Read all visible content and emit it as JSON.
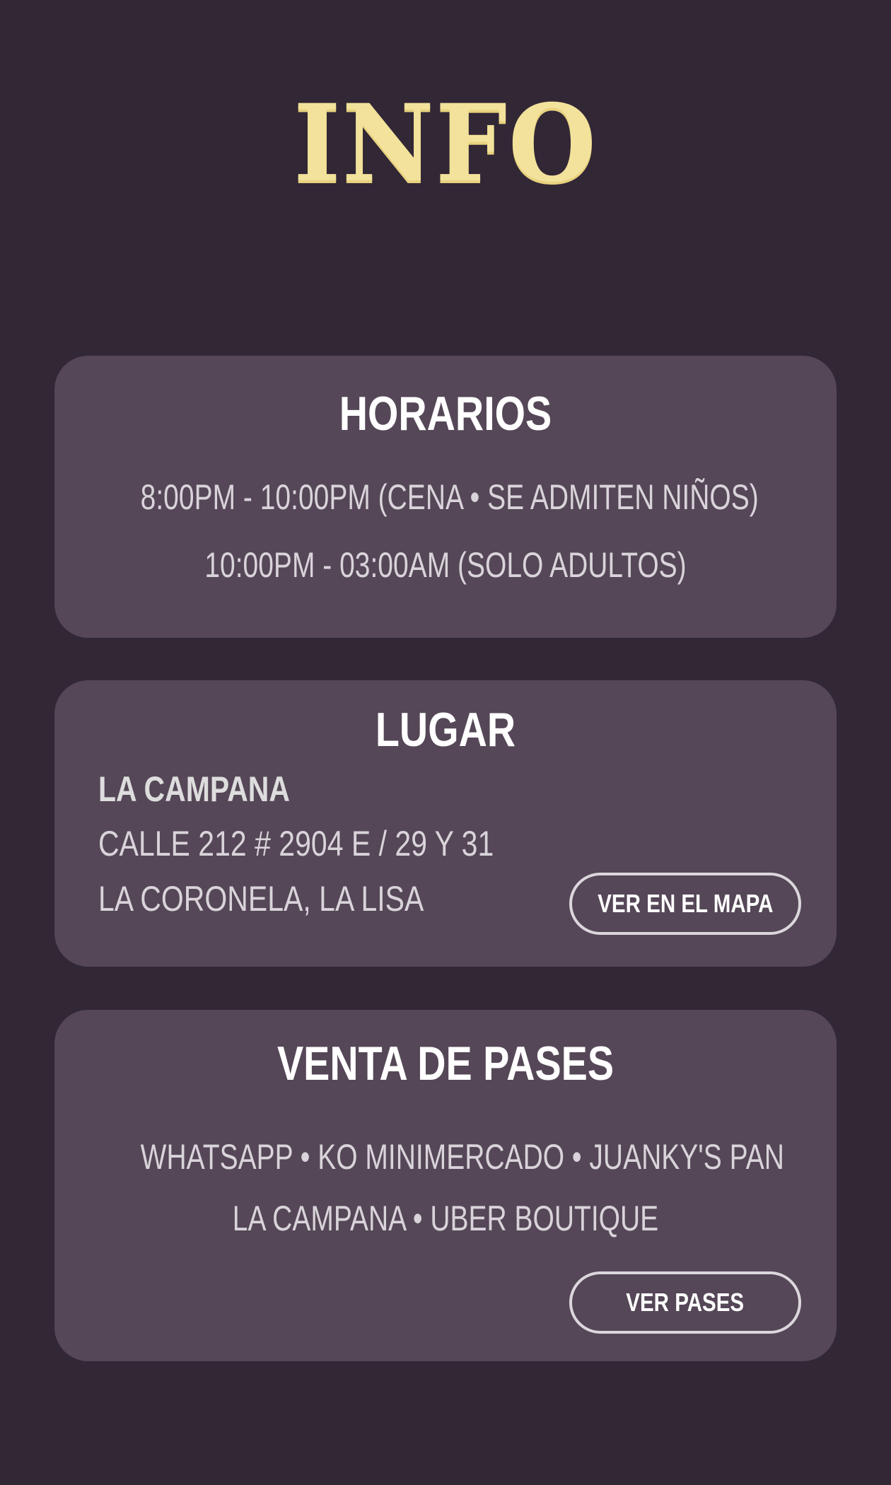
{
  "page_title": "INFO",
  "accent_color": "#f2e29b",
  "horarios": {
    "title": "HORARIOS",
    "line1": "8:00PM - 10:00PM  (CENA • SE ADMITEN NIÑOS)",
    "line2": "10:00PM - 03:00AM  (SOLO ADULTOS)"
  },
  "lugar": {
    "title": "LUGAR",
    "venue": "LA CAMPANA",
    "address_line1": "CALLE 212 # 2904  E / 29 Y 31",
    "address_line2": "LA CORONELA, LA LISA",
    "map_button": "VER EN EL MAPA"
  },
  "venta": {
    "title": "VENTA DE PASES",
    "line1": "WHATSAPP • KO MINIMERCADO • JUANKY'S PAN",
    "line2": "LA CAMPANA • UBER BOUTIQUE",
    "passes_button": "VER PASES"
  }
}
